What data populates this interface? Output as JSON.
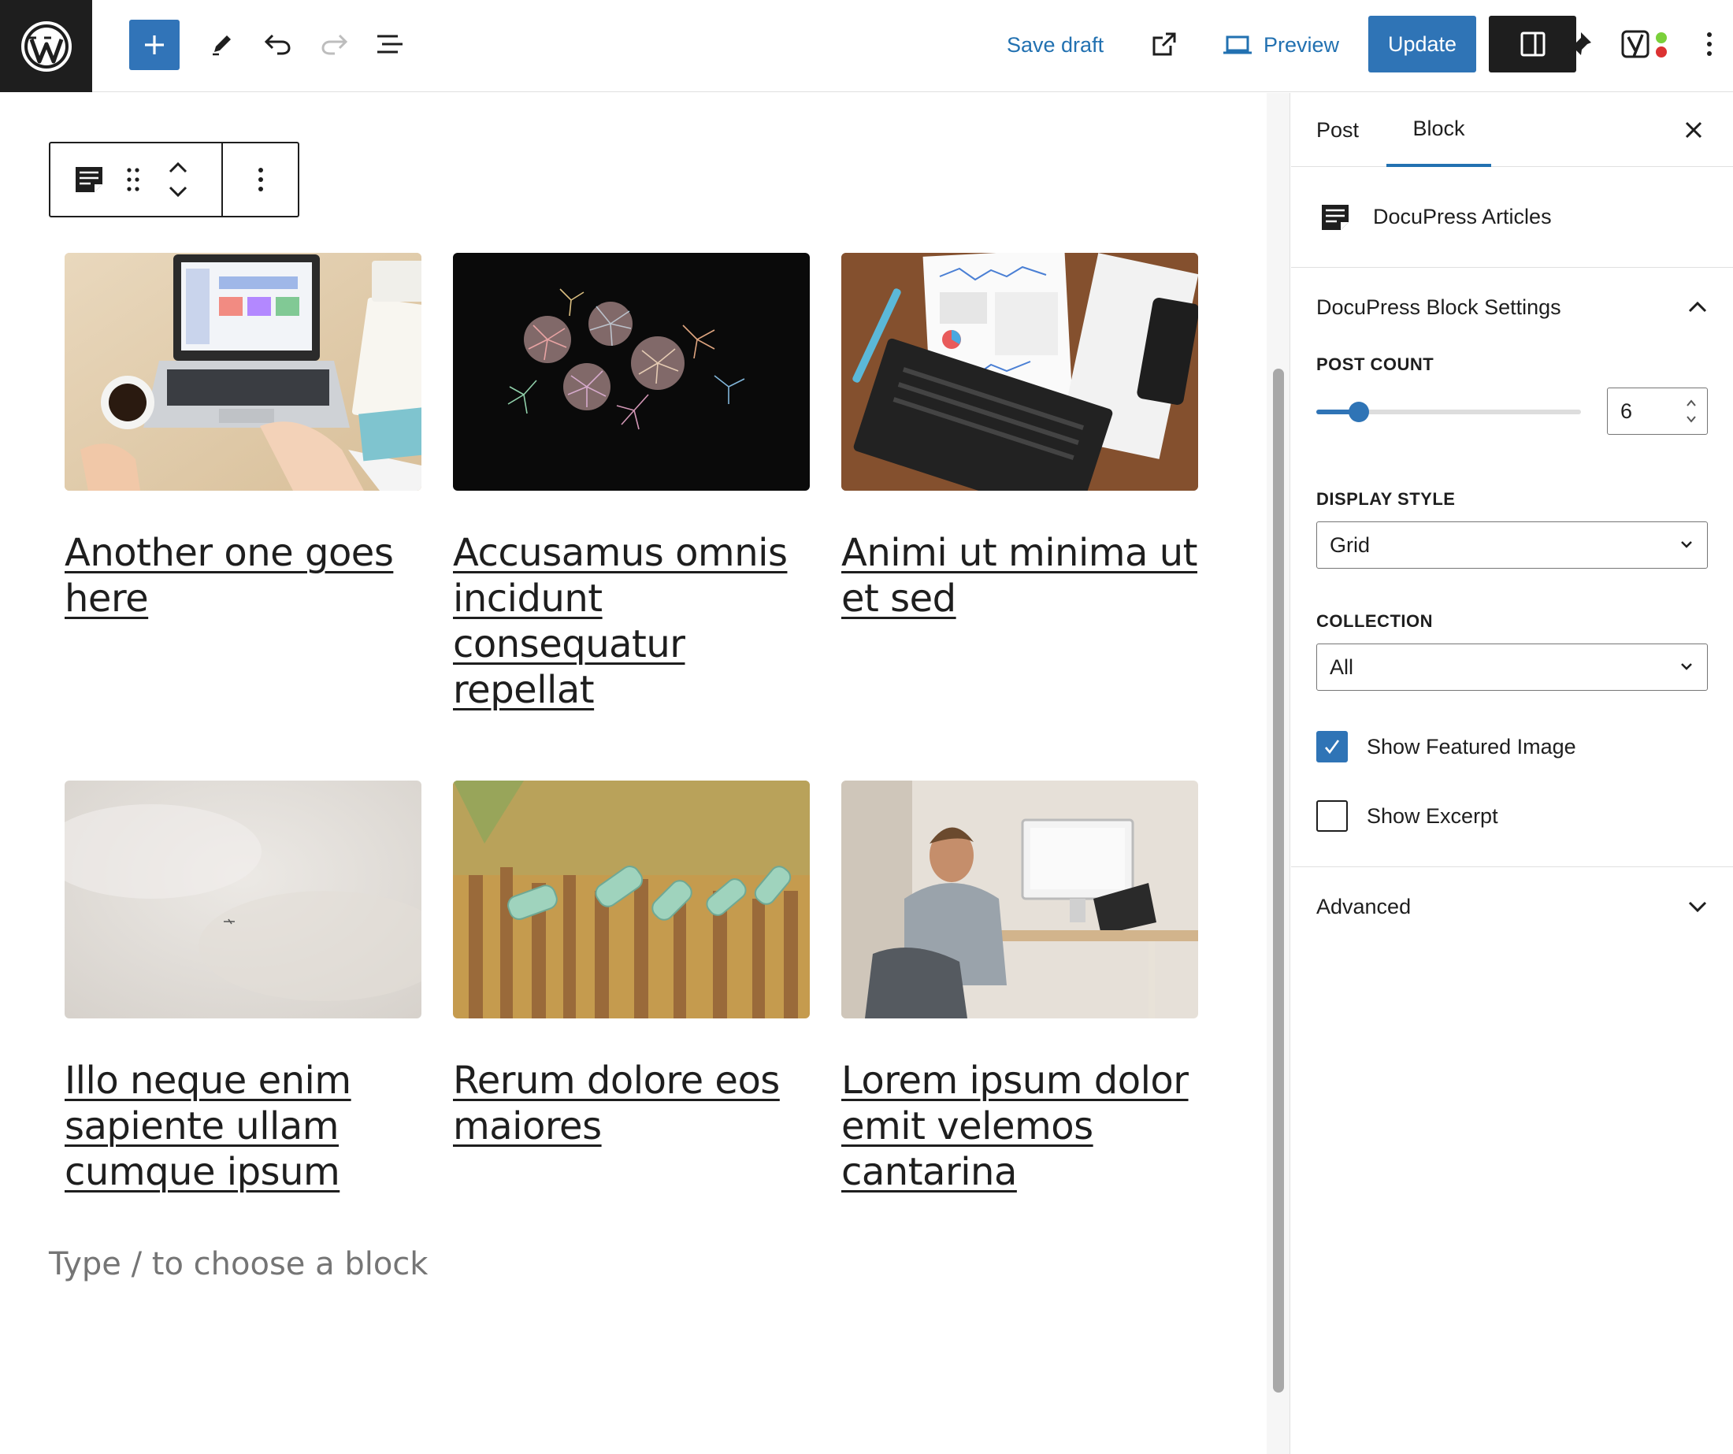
{
  "toolbar": {
    "save_draft_label": "Save draft",
    "preview_label": "Preview",
    "update_label": "Update",
    "icons": [
      "wordpress-logo",
      "plus-icon",
      "pencil-icon",
      "undo-icon",
      "redo-icon",
      "list-view-icon",
      "external-link-icon",
      "laptop-icon",
      "sidebar-icon",
      "pin-icon",
      "yoast-icon",
      "more-vertical-icon"
    ],
    "accent": "#2f74b6"
  },
  "editor": {
    "posts": [
      {
        "title": "Another one goes here",
        "image": "laptop-desk-photo"
      },
      {
        "title": "Accusamus omnis incidunt consequatur repellat",
        "image": "fireworks-photo"
      },
      {
        "title": "Animi ut minima ut et sed",
        "image": "dashboard-printouts-photo"
      },
      {
        "title": "Illo neque enim sapiente ullam cumque ipsum",
        "image": "foggy-sky-photo"
      },
      {
        "title": "Rerum dolore eos maiores",
        "image": "glass-bottles-fence-photo"
      },
      {
        "title": "Lorem ipsum dolor emit velemos cantarina",
        "image": "man-at-desk-photo"
      }
    ],
    "placeholder": "Type / to choose a block"
  },
  "sidebar": {
    "tabs": [
      "Post",
      "Block"
    ],
    "active_tab": "Block",
    "block_name": "DocuPress Articles",
    "settings_panel_title": "DocuPress Block Settings",
    "post_count_label": "POST COUNT",
    "post_count_value": "6",
    "post_count_slider_fraction": 0.16,
    "display_style_label": "DISPLAY STYLE",
    "display_style_value": "Grid",
    "collection_label": "COLLECTION",
    "collection_value": "All",
    "show_featured_image_label": "Show Featured Image",
    "show_featured_image_checked": true,
    "show_excerpt_label": "Show Excerpt",
    "show_excerpt_checked": false,
    "advanced_label": "Advanced"
  }
}
